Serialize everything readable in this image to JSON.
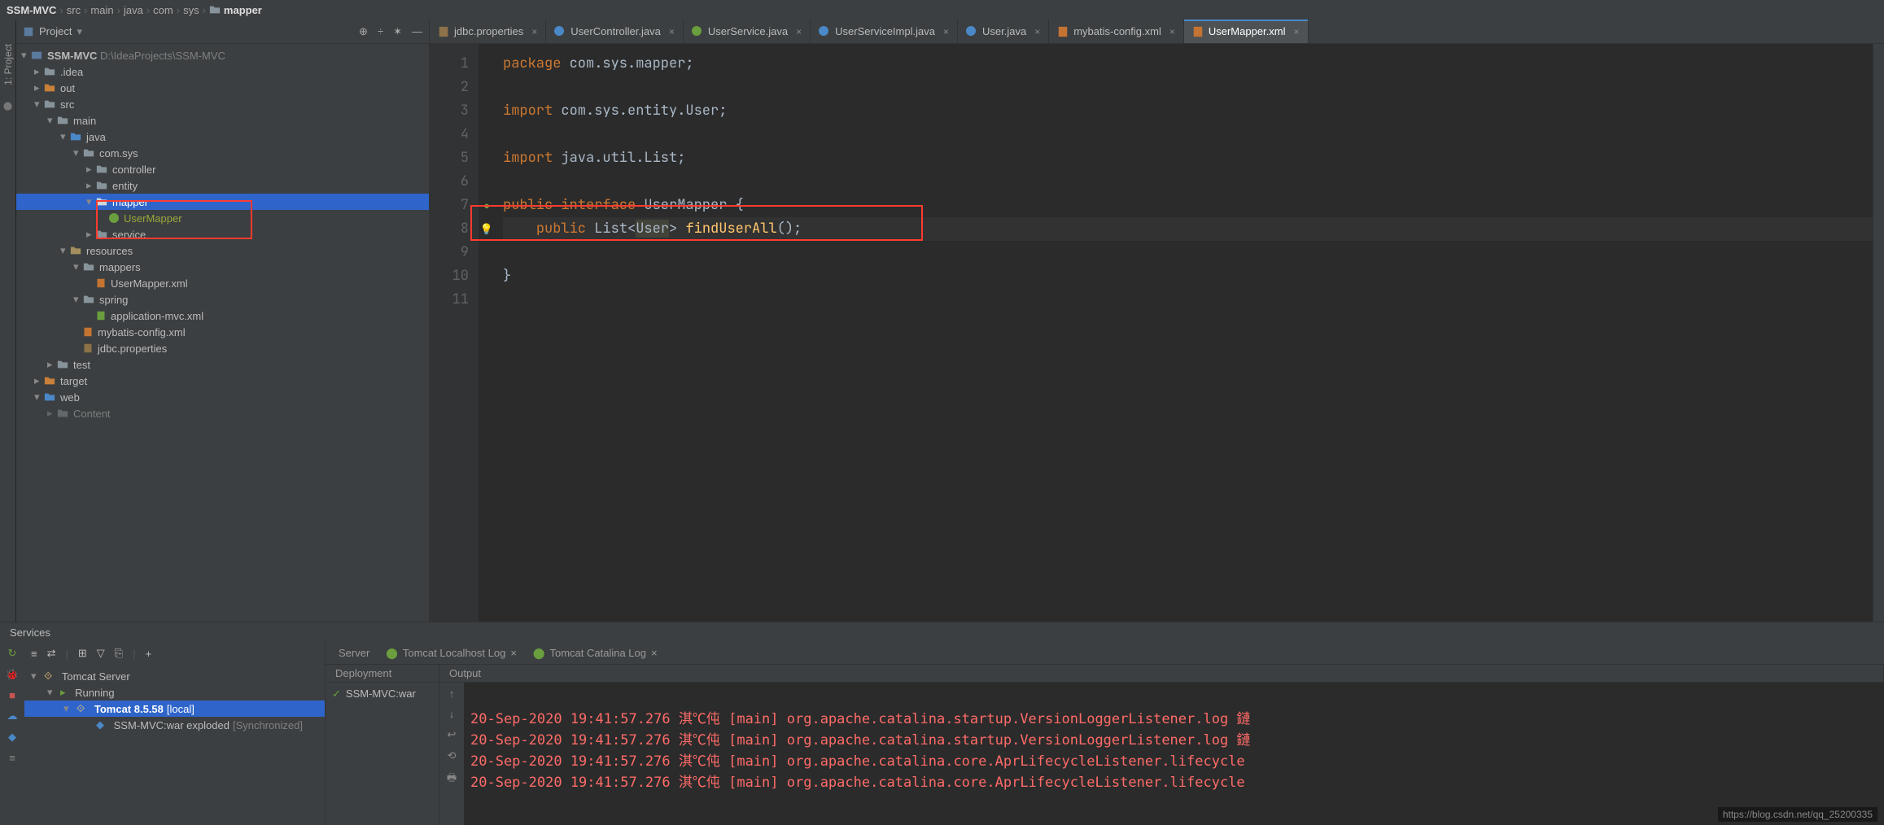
{
  "breadcrumbs": [
    "SSM-MVC",
    "src",
    "main",
    "java",
    "com",
    "sys",
    "mapper"
  ],
  "project_panel": {
    "title": "Project",
    "root": {
      "name": "SSM-MVC",
      "path": "D:\\IdeaProjects\\SSM-MVC"
    }
  },
  "tree": {
    "idea": ".idea",
    "out": "out",
    "src": "src",
    "main": "main",
    "java": "java",
    "com_sys": "com.sys",
    "controller": "controller",
    "entity": "entity",
    "mapper": "mapper",
    "user_mapper": "UserMapper",
    "service": "service",
    "resources": "resources",
    "mappers": "mappers",
    "user_mapper_xml": "UserMapper.xml",
    "spring": "spring",
    "application_mvc_xml": "application-mvc.xml",
    "mybatis_config_xml": "mybatis-config.xml",
    "jdbc_properties": "jdbc.properties",
    "test": "test",
    "target": "target",
    "web": "web",
    "content": "Content"
  },
  "tabs": [
    {
      "label": "jdbc.properties",
      "icon": "properties"
    },
    {
      "label": "UserController.java",
      "icon": "java-class"
    },
    {
      "label": "UserService.java",
      "icon": "java-interface"
    },
    {
      "label": "UserServiceImpl.java",
      "icon": "java-class"
    },
    {
      "label": "User.java",
      "icon": "java-class"
    },
    {
      "label": "mybatis-config.xml",
      "icon": "xml"
    },
    {
      "label": "UserMapper.xml",
      "icon": "xml",
      "active": true
    }
  ],
  "code": {
    "l1": {
      "kw": "package ",
      "rest": "com.sys.mapper;"
    },
    "l3": {
      "kw": "import ",
      "rest": "com.sys.entity.User;"
    },
    "l5": {
      "kw": "import ",
      "rest": "java.util.List;"
    },
    "l7": {
      "kw1": "public interface",
      "name": " UserMapper ",
      "brace": "{"
    },
    "l8": {
      "kw": "public",
      "list": "List",
      "open": "<",
      "user": "User",
      "close": "> ",
      "fn": "findUserAll",
      "tail": "();"
    },
    "l10": "}"
  },
  "services": {
    "title": "Services",
    "tomcat_server": "Tomcat Server",
    "running": "Running",
    "tomcat": "Tomcat 8.5.58",
    "local": " [local]",
    "war": "SSM-MVC:war exploded",
    "sync": " [Synchronized]",
    "deploy_label": "SSM-MVC:war"
  },
  "bp_tabs": {
    "server": "Server",
    "localhost": "Tomcat Localhost Log",
    "catalina": "Tomcat Catalina Log"
  },
  "bp_cols": {
    "deployment": "Deployment",
    "output": "Output"
  },
  "output": [
    "20-Sep-2020 19:41:57.276 淇℃伅 [main] org.apache.catalina.startup.VersionLoggerListener.log 鏈",
    "20-Sep-2020 19:41:57.276 淇℃伅 [main] org.apache.catalina.startup.VersionLoggerListener.log 鏈",
    "20-Sep-2020 19:41:57.276 淇℃伅 [main] org.apache.catalina.core.AprLifecycleListener.lifecycle",
    "20-Sep-2020 19:41:57.276 淇℃伅 [main] org.apache.catalina.core.AprLifecycleListener.lifecycle"
  ],
  "watermark": "https://blog.csdn.net/qq_25200335"
}
